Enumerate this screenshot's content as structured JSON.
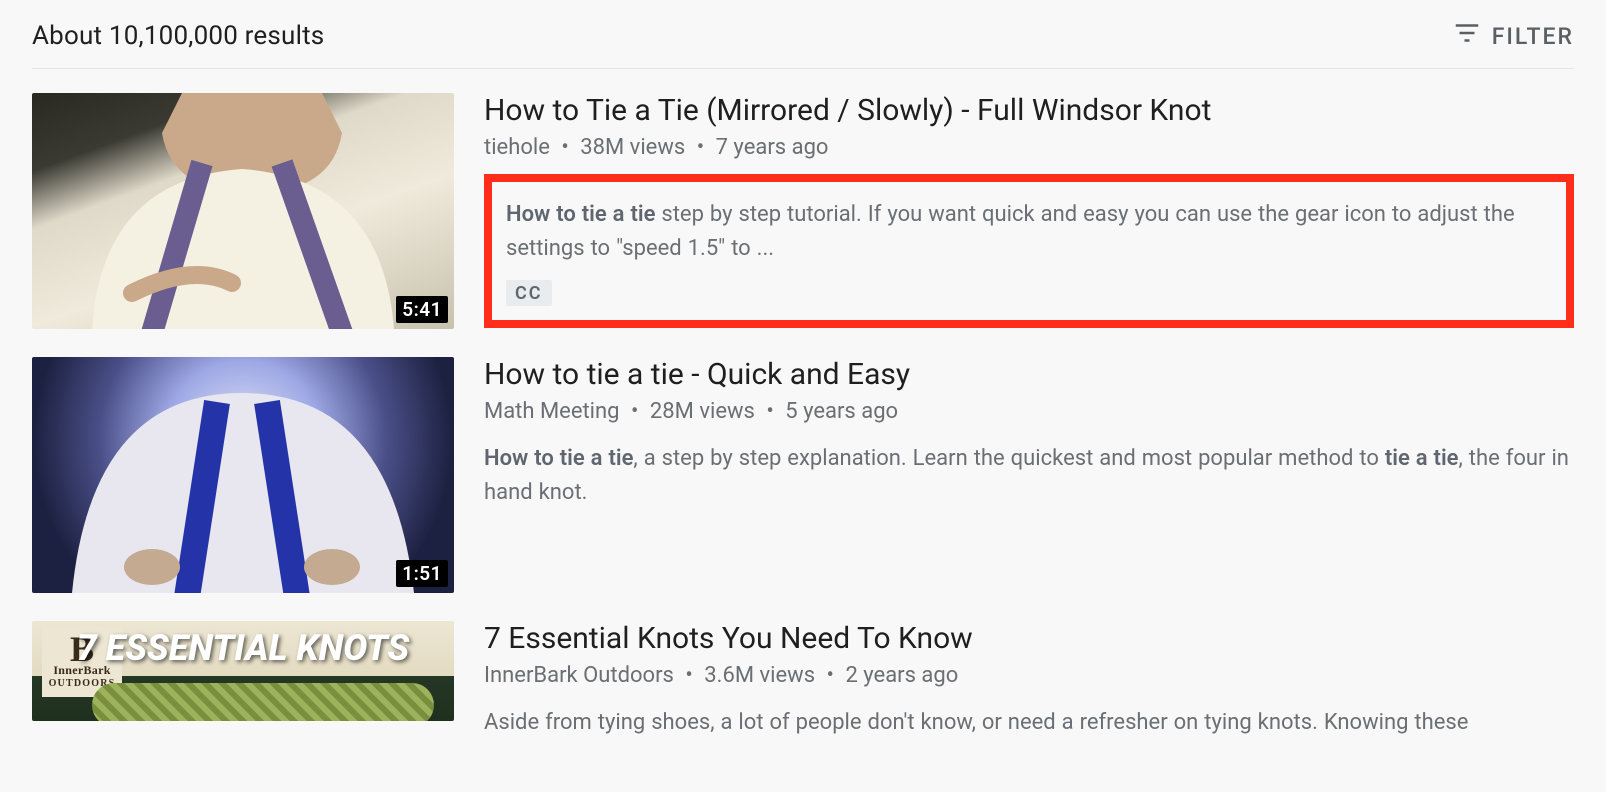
{
  "header": {
    "results_label": "About 10,100,000 results",
    "filter_label": "FILTER"
  },
  "dot": "•",
  "results": [
    {
      "title": "How to Tie a Tie (Mirrored / Slowly) - Full Windsor Knot",
      "channel": "tiehole",
      "views": "38M views",
      "age": "7 years ago",
      "duration": "5:41",
      "desc_bold": "How to tie a tie",
      "desc_rest": " step by step tutorial. If you want quick and easy you can use the gear icon to adjust the settings to \"speed 1.5\" to ...",
      "badge": "CC",
      "highlighted": true
    },
    {
      "title": "How to tie a tie - Quick and Easy",
      "channel": "Math Meeting",
      "views": "28M views",
      "age": "5 years ago",
      "duration": "1:51",
      "desc_bold": "How to tie a tie",
      "desc_rest": ", a step by step explanation. Learn the quickest and most popular method to ",
      "desc_bold2": "tie a tie",
      "desc_rest2": ", the four in hand knot."
    },
    {
      "title": "7 Essential Knots You Need To Know",
      "channel": "InnerBark Outdoors",
      "views": "3.6M views",
      "age": "2 years ago",
      "desc_rest": "Aside from tying shoes, a lot of people don't know, or need a refresher on tying knots. Knowing these",
      "thumb_overlay": "7 ESSENTIAL KNOTS",
      "logo": {
        "b": "B",
        "line1": "InnerBark",
        "line2": "OUTDOORS"
      }
    }
  ]
}
